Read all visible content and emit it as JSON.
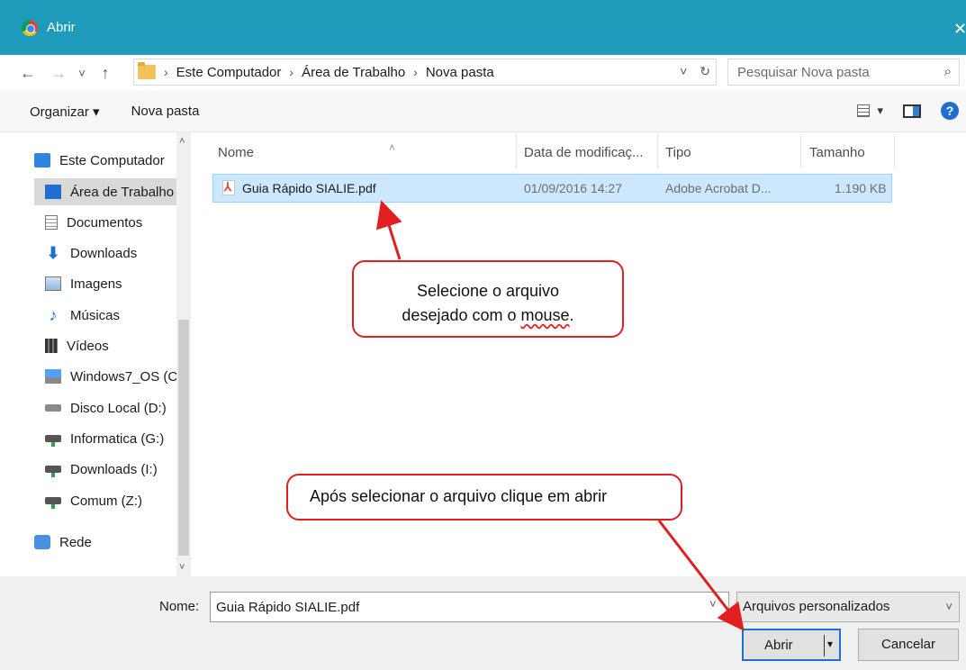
{
  "window": {
    "title": "Abrir",
    "close_glyph": "✕"
  },
  "address": {
    "back": "←",
    "forward": "→",
    "recent": "˅",
    "up": "↑",
    "separator": "›",
    "crumbs": [
      "Este Computador",
      "Área de Trabalho",
      "Nova pasta"
    ],
    "dropdown": "˅",
    "refresh": "↻",
    "search_placeholder": "Pesquisar Nova pasta"
  },
  "toolbar": {
    "organize_label": "Organizar ▾",
    "new_folder_label": "Nova pasta",
    "view_dropdown": "▾",
    "help": "?"
  },
  "sidebar": {
    "items": [
      {
        "label": "Este Computador",
        "icon": "computer-icon"
      },
      {
        "label": "Área de Trabalho",
        "icon": "desktop-icon"
      },
      {
        "label": "Documentos",
        "icon": "documents-icon"
      },
      {
        "label": "Downloads",
        "icon": "downloads-icon"
      },
      {
        "label": "Imagens",
        "icon": "images-icon"
      },
      {
        "label": "Músicas",
        "icon": "music-icon"
      },
      {
        "label": "Vídeos",
        "icon": "videos-icon"
      },
      {
        "label": "Windows7_OS (C",
        "icon": "windows-drive-icon"
      },
      {
        "label": "Disco Local (D:)",
        "icon": "disk-drive-icon"
      },
      {
        "label": "Informatica (G:)",
        "icon": "network-drive-icon"
      },
      {
        "label": "Downloads (I:)",
        "icon": "network-drive-icon"
      },
      {
        "label": "Comum (Z:)",
        "icon": "network-drive-icon"
      },
      {
        "label": "Rede",
        "icon": "network-icon"
      }
    ],
    "scroll_up": "˄",
    "scroll_down": "˅"
  },
  "file_list": {
    "sort_indicator": "˄",
    "columns": [
      "Nome",
      "Data de modificaç...",
      "Tipo",
      "Tamanho"
    ],
    "rows": [
      {
        "name": "Guia Rápido SIALIE.pdf",
        "modified": "01/09/2016 14:27",
        "type": "Adobe Acrobat D...",
        "size": "1.190 KB",
        "icon": "pdf-icon"
      }
    ]
  },
  "annotations": {
    "callout1_line1": "Selecione o arquivo",
    "callout1_line2a": "desejado com o ",
    "callout1_line2b": "mouse",
    "callout1_line2c": ".",
    "callout2": "Após selecionar o arquivo clique em abrir",
    "color": "#e02020"
  },
  "footer": {
    "name_label": "Nome:",
    "name_value": "Guia Rápido SIALIE.pdf",
    "name_dropdown": "˅",
    "file_type": "Arquivos personalizados",
    "file_type_dropdown": "˅",
    "open_label": "Abrir",
    "open_dropdown": "▾",
    "cancel_label": "Cancelar"
  },
  "colors": {
    "titlebar": "#1e9bba",
    "selection": "#cce8ff",
    "accent": "#1f6fd1"
  }
}
